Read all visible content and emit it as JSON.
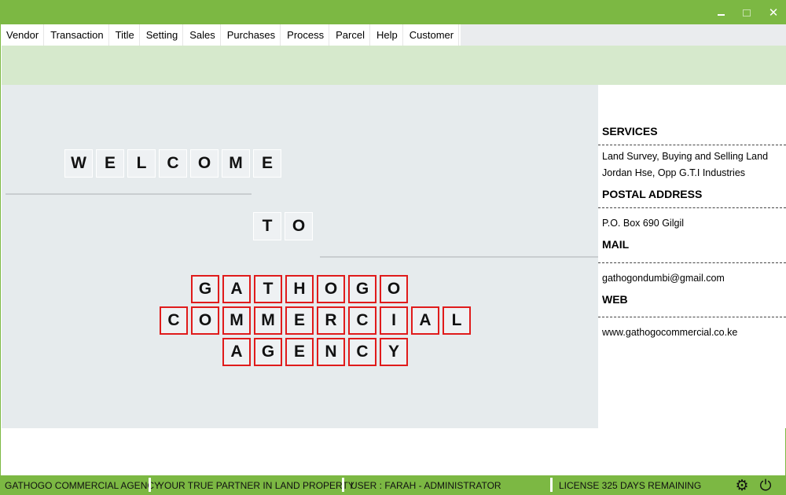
{
  "menu": [
    "Vendor",
    "Transaction",
    "Title",
    "Setting",
    "Sales",
    "Purchases",
    "Process",
    "Parcel",
    "Help",
    "Customer"
  ],
  "window_controls": {
    "minimize_icon": "minimize-icon",
    "maximize_icon": "maximize-icon",
    "close_icon": "close-icon",
    "close_glyph": "✕"
  },
  "banner": {
    "welcome": [
      "W",
      "E",
      "L",
      "C",
      "O",
      "M",
      "E"
    ],
    "to": [
      "T",
      "O"
    ],
    "line1": [
      "G",
      "A",
      "T",
      "H",
      "O",
      "G",
      "O"
    ],
    "line2": [
      "C",
      "O",
      "M",
      "M",
      "E",
      "R",
      "C",
      "I",
      "A",
      "L"
    ],
    "line3": [
      "A",
      "G",
      "E",
      "N",
      "C",
      "Y"
    ]
  },
  "info": {
    "services_heading": "SERVICES",
    "services_line1": "Land Survey, Buying and Selling Land",
    "services_line2": "Jordan Hse, Opp G.T.I Industries",
    "postal_heading": "POSTAL ADDRESS",
    "postal_value": "P.O. Box 690 Gilgil",
    "mail_heading": "MAIL",
    "mail_value": "gathogondumbi@gmail.com",
    "web_heading": "WEB",
    "web_value": "www.gathogocommercial.co.ke"
  },
  "status": {
    "company": "GATHOGO COMMERCIAL AGENCY",
    "tagline": "YOUR TRUE PARTNER IN LAND PROPERTY",
    "user": "USER : FARAH - ADMINISTRATOR",
    "license": "LICENSE 325 DAYS REMAINING",
    "settings_glyph": "⚙",
    "power_glyph": "⏻"
  },
  "colors": {
    "accent_green": "#7cb843",
    "band_green": "#d6e9cc",
    "canvas_gray": "#e6ebed",
    "tile_red_border": "#e01b1b"
  }
}
